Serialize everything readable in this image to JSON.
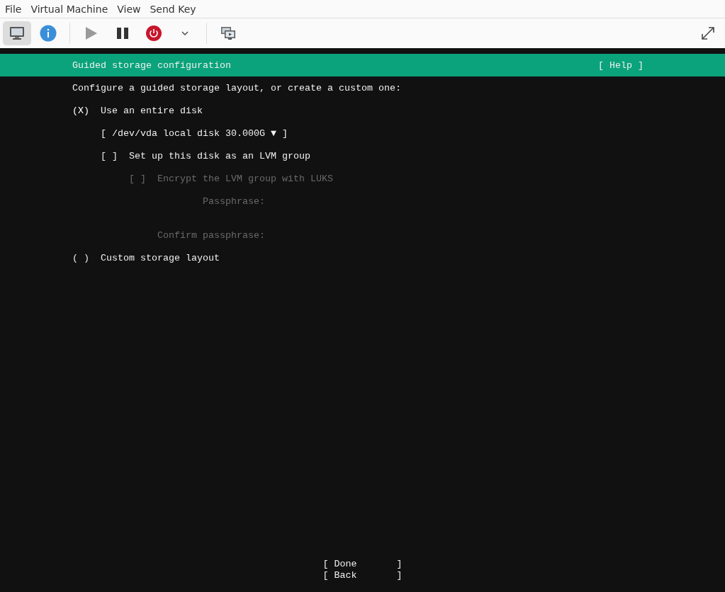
{
  "menu": [
    "File",
    "Virtual Machine",
    "View",
    "Send Key"
  ],
  "toolbar": {
    "console_selected": true,
    "run_disabled": true
  },
  "header": {
    "title": "Guided storage configuration",
    "help": "[ Help ]"
  },
  "intro": "Configure a guided storage layout, or create a custom one:",
  "entire_disk": {
    "marker": "(X)",
    "label": "Use an entire disk",
    "selected": true,
    "disk": "[ /dev/vda local disk 30.000G ▼ ]",
    "lvm": {
      "marker": "[ ]",
      "label": "Set up this disk as an LVM group",
      "checked": false,
      "encrypt": {
        "marker": "[ ]",
        "label": "Encrypt the LVM group with LUKS",
        "checked": false,
        "disabled": true
      },
      "passphrase_label": "Passphrase:",
      "confirm_label": "Confirm passphrase:"
    }
  },
  "custom": {
    "marker": "( )",
    "label": "Custom storage layout",
    "selected": false
  },
  "buttons": [
    "[ Done       ]",
    "[ Back       ]"
  ]
}
